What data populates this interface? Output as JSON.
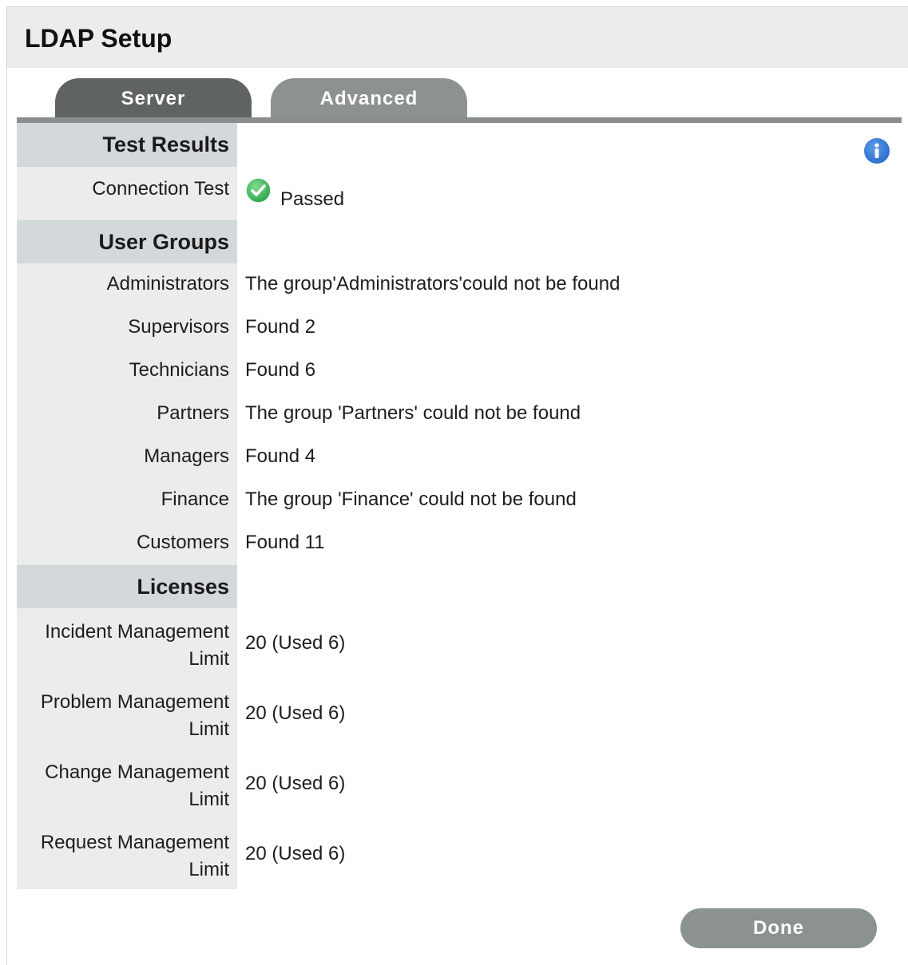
{
  "page": {
    "title": "LDAP Setup"
  },
  "tabs": [
    {
      "label": "Server"
    },
    {
      "label": "Advanced"
    }
  ],
  "sections": {
    "test_results": {
      "heading": "Test Results",
      "connection_test": {
        "label": "Connection Test",
        "value": "Passed"
      }
    },
    "user_groups": {
      "heading": "User Groups",
      "rows": [
        {
          "label": "Administrators",
          "value": "The group'Administrators'could not be found"
        },
        {
          "label": "Supervisors",
          "value": "Found 2"
        },
        {
          "label": "Technicians",
          "value": "Found 6"
        },
        {
          "label": "Partners",
          "value": "The group 'Partners' could not be found"
        },
        {
          "label": "Managers",
          "value": "Found 4"
        },
        {
          "label": "Finance",
          "value": "The group 'Finance' could not be found"
        },
        {
          "label": "Customers",
          "value": "Found 11"
        }
      ]
    },
    "licenses": {
      "heading": "Licenses",
      "rows": [
        {
          "label_line1": "Incident Management",
          "label_line2": "Limit",
          "value": "20 (Used 6)"
        },
        {
          "label_line1": "Problem Management",
          "label_line2": "Limit",
          "value": "20 (Used 6)"
        },
        {
          "label_line1": "Change Management",
          "label_line2": "Limit",
          "value": "20 (Used 6)"
        },
        {
          "label_line1": "Request Management",
          "label_line2": "Limit",
          "value": "20 (Used 6)"
        }
      ]
    }
  },
  "actions": {
    "done_label": "Done"
  },
  "icons": {
    "info": "info-icon",
    "status": "check-circle-icon"
  },
  "colors": {
    "tab_active": "#5f6364",
    "tab_inactive": "#8c9192",
    "section_bg": "#d3d8db",
    "label_bg": "#ececec",
    "info_blue": "#1d5fc2",
    "check_green": "#3cb95c"
  }
}
